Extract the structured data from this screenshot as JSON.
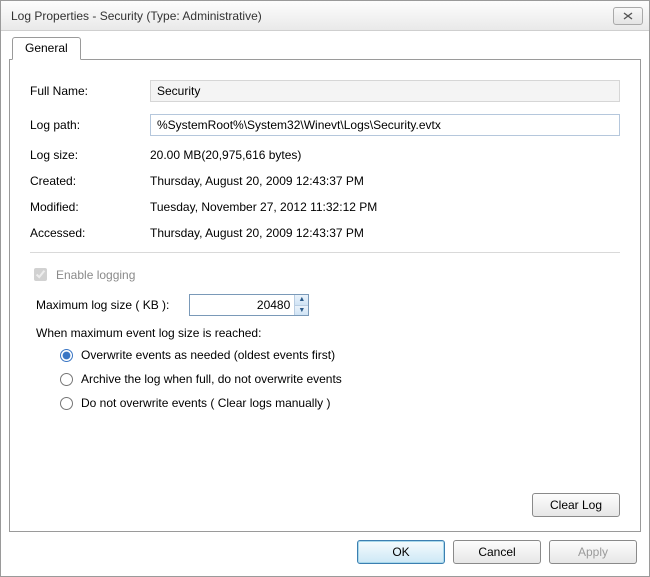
{
  "window": {
    "title": "Log Properties - Security (Type: Administrative)"
  },
  "tabs": {
    "general": "General"
  },
  "fields": {
    "full_name_label": "Full Name:",
    "full_name_value": "Security",
    "log_path_label": "Log path:",
    "log_path_value": "%SystemRoot%\\System32\\Winevt\\Logs\\Security.evtx",
    "log_size_label": "Log size:",
    "log_size_value": "20.00 MB(20,975,616 bytes)",
    "created_label": "Created:",
    "created_value": "Thursday, August 20, 2009 12:43:37 PM",
    "modified_label": "Modified:",
    "modified_value": "Tuesday, November 27, 2012 11:32:12 PM",
    "accessed_label": "Accessed:",
    "accessed_value": "Thursday, August 20, 2009 12:43:37 PM"
  },
  "logging": {
    "enable_label": "Enable logging",
    "max_size_label": "Maximum log size ( KB ):",
    "max_size_value": "20480",
    "when_max_label": "When maximum event log size is reached:",
    "options": {
      "overwrite": "Overwrite events as needed (oldest events first)",
      "archive": "Archive the log when full, do not overwrite events",
      "none": "Do not overwrite events ( Clear logs manually )"
    }
  },
  "buttons": {
    "clear_log": "Clear Log",
    "ok": "OK",
    "cancel": "Cancel",
    "apply": "Apply"
  }
}
